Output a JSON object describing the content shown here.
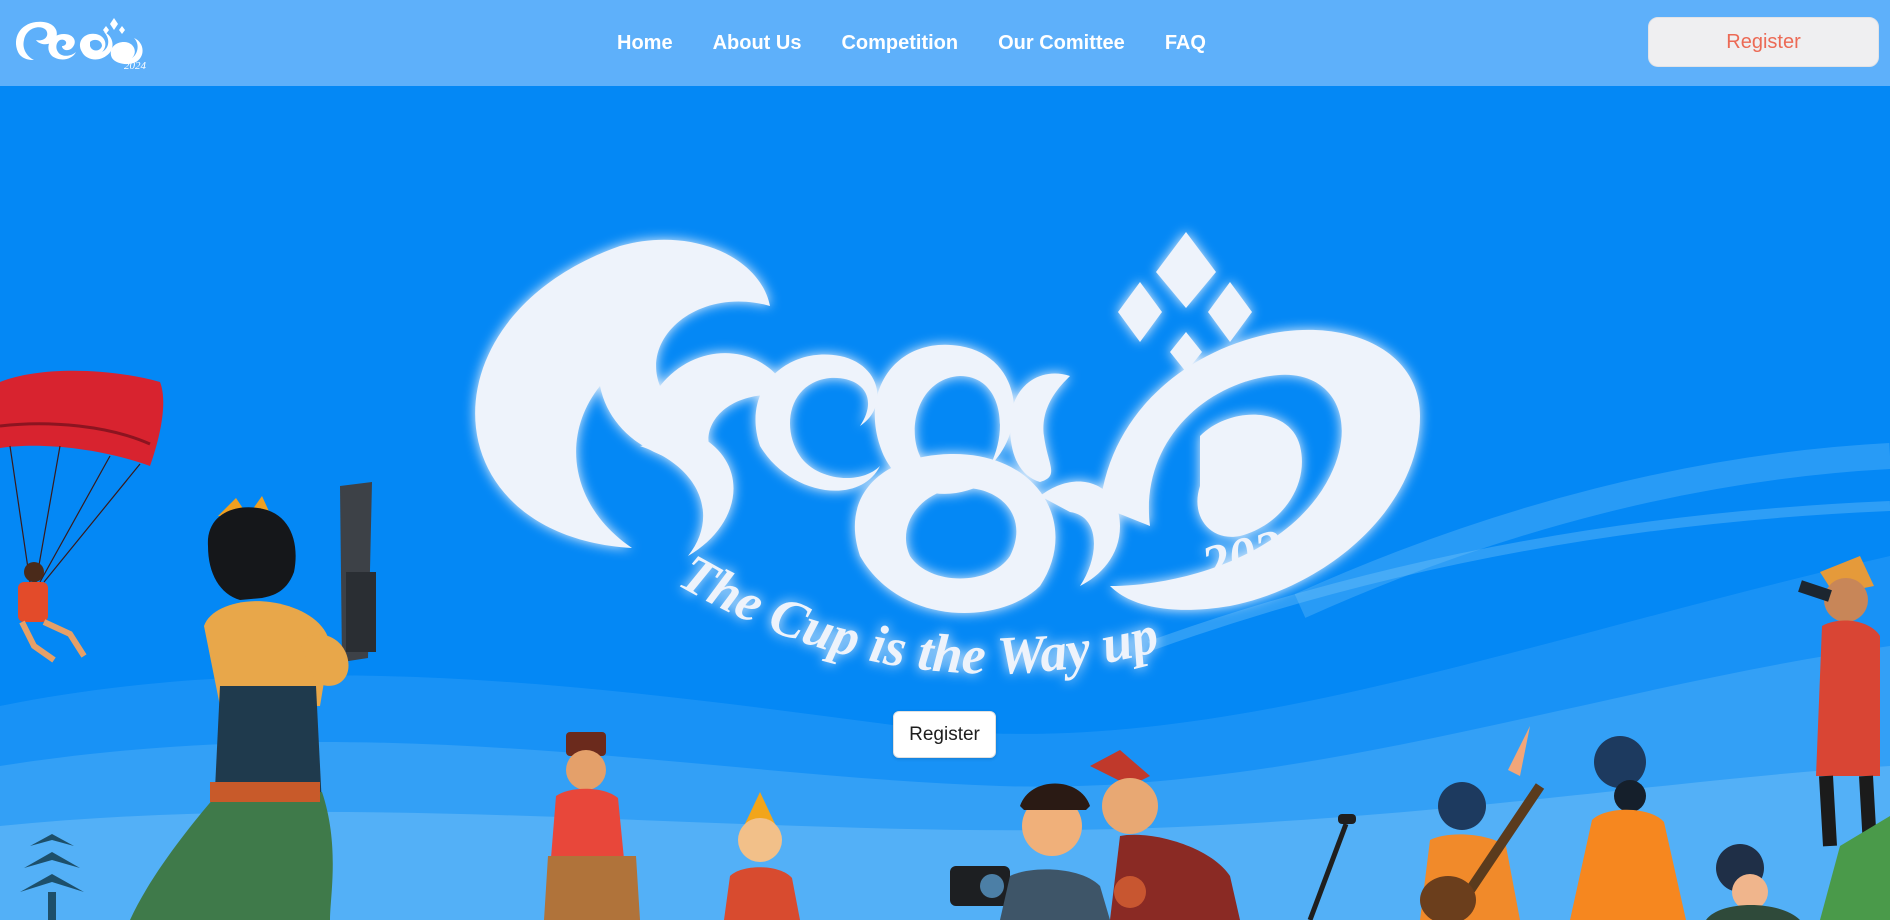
{
  "brand": {
    "logo_text": "Recton Cup",
    "logo_year": "2024"
  },
  "nav": {
    "items": [
      {
        "label": "Home"
      },
      {
        "label": "About Us"
      },
      {
        "label": "Competition"
      },
      {
        "label": "Our Comittee"
      },
      {
        "label": "FAQ"
      }
    ],
    "register_label": "Register"
  },
  "hero": {
    "logo_text": "Recton Cup",
    "logo_year": "2024",
    "tagline": "The Cup is the Way up",
    "register_label": "Register"
  },
  "colors": {
    "navbar_bg": "#5eb0fa",
    "hero_bg": "#0488f5",
    "logo_white": "#eef3fb",
    "nav_register_text": "#ec6a55"
  }
}
